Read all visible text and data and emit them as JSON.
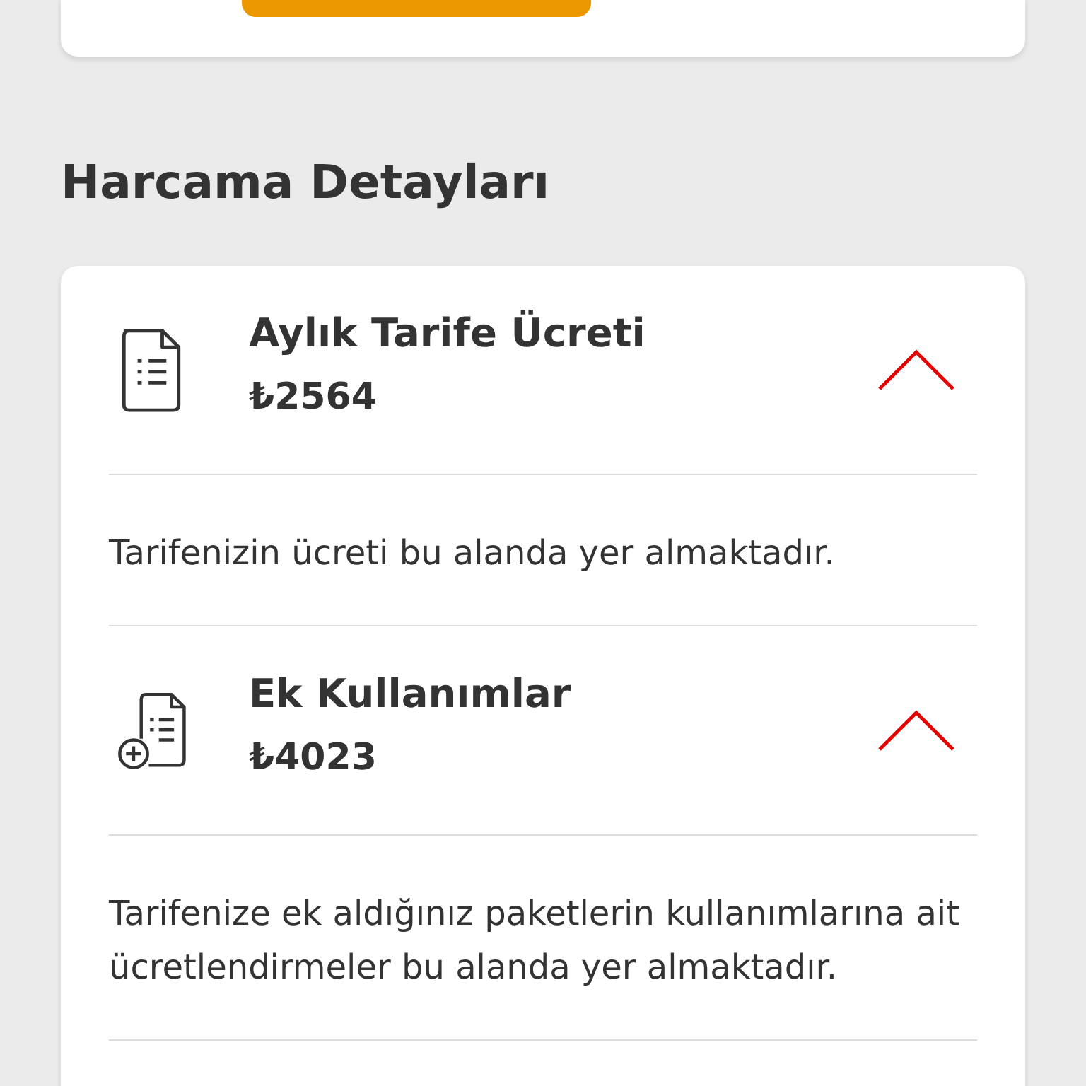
{
  "heading": "Harcama Detayları",
  "items": [
    {
      "kind": "document",
      "title": "Aylık Tarife Ücreti",
      "amount": "₺2564",
      "expanded": true,
      "description": "Tarifenizin ücreti bu alanda yer almaktadır."
    },
    {
      "kind": "document-add",
      "title": "Ek Kullanımlar",
      "amount": "₺4023",
      "expanded": true,
      "description": "Tarifenize ek aldığınız paketlerin kullanımlarına ait ücretlendirmeler bu alanda yer almaktadır."
    }
  ]
}
